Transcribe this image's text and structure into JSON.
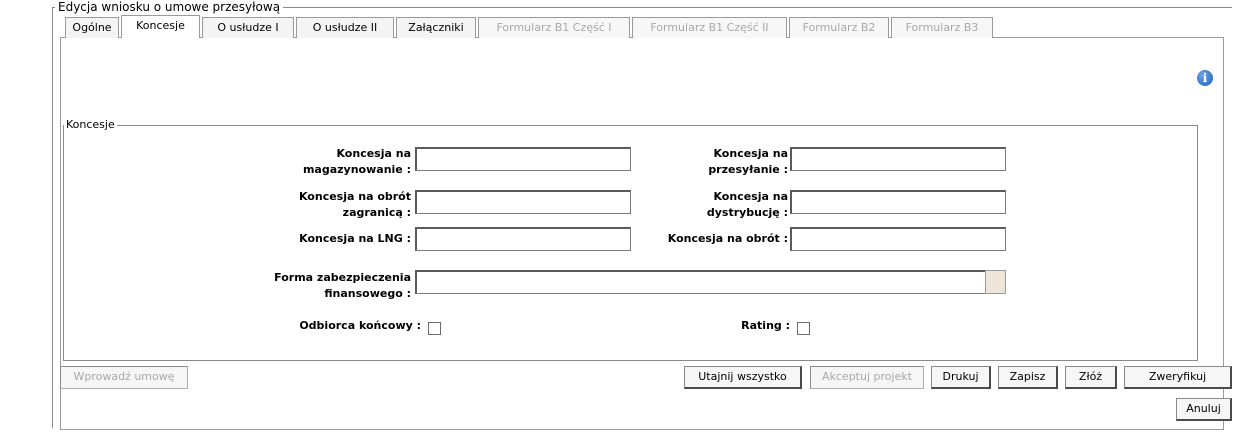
{
  "form": {
    "title": "Edycja wniosku o umowe przesyłową"
  },
  "tabs": [
    {
      "label": "Ogólne",
      "state": "normal"
    },
    {
      "label": "Koncesje",
      "state": "active"
    },
    {
      "label": "O usłudze I",
      "state": "normal"
    },
    {
      "label": "O usłudze II",
      "state": "normal"
    },
    {
      "label": "Załączniki",
      "state": "normal"
    },
    {
      "label": "Formularz B1 Część I",
      "state": "disabled"
    },
    {
      "label": "Formularz B1 Część II",
      "state": "disabled"
    },
    {
      "label": "Formularz B2",
      "state": "disabled"
    },
    {
      "label": "Formularz B3",
      "state": "disabled"
    }
  ],
  "info_icon": "info-icon",
  "section": {
    "legend": "Koncesje"
  },
  "fields": {
    "storage": {
      "label_line1": "Koncesja na",
      "label_line2": "magazynowanie :",
      "value": ""
    },
    "transmission": {
      "label_line1": "Koncesja na",
      "label_line2": "przesyłanie :",
      "value": ""
    },
    "foreign_trade": {
      "label_line1": "Koncesja na obrót",
      "label_line2": "zagranicą :",
      "value": ""
    },
    "distribution": {
      "label_line1": "Koncesja na",
      "label_line2": "dystrybucję :",
      "value": ""
    },
    "lng": {
      "label": "Koncesja na LNG :",
      "value": ""
    },
    "trade": {
      "label": "Koncesja na obrót :",
      "value": ""
    },
    "security": {
      "label_line1": "Forma zabezpieczenia",
      "label_line2": "finansowego :",
      "value": ""
    },
    "end_customer": {
      "label": "Odbiorca końcowy :",
      "checked": false
    },
    "rating": {
      "label": "Rating :",
      "checked": false
    }
  },
  "buttons": {
    "enter_contract": "Wprowadź umowę",
    "hide_all": "Utajnij wszystko",
    "accept_project": "Akceptuj projekt",
    "print": "Drukuj",
    "save": "Zapisz",
    "submit": "Złóż",
    "verify": "Zweryfikuj",
    "cancel": "Anuluj"
  }
}
